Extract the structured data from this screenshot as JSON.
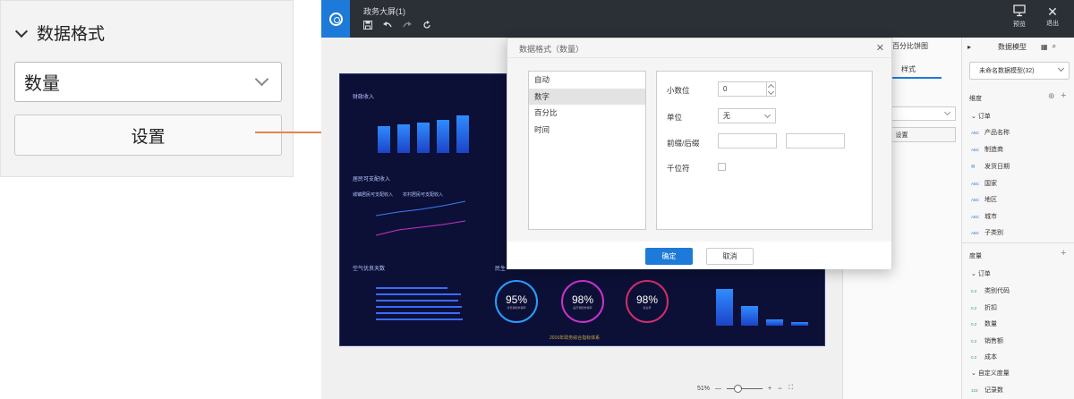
{
  "callout": {
    "section_title": "数据格式",
    "format_value": "数量",
    "settings_button": "设置"
  },
  "app": {
    "doc_title": "政务大屏(1)",
    "preview_label": "预览",
    "exit_label": "退出",
    "zoom_level": "51%"
  },
  "dashboard": {
    "panel_titles": [
      "财政收入",
      "居民可支配收入",
      "空气优良天数",
      "民生"
    ],
    "legend_items": [
      "城镇居民可支配收入",
      "农村居民可支配收入"
    ],
    "gauges": [
      {
        "pct": "95%",
        "label": "养老保险参保率"
      },
      {
        "pct": "98%",
        "label": "医疗保险参保率"
      },
      {
        "pct": "98%",
        "label": "就业率"
      }
    ],
    "footer": "2016年政务综合指标体系"
  },
  "property_panel": {
    "title": "百分比饼图",
    "tab_style": "样式",
    "settings_button": "设置"
  },
  "data_model": {
    "header_title": "数据模型",
    "model_select": "未命名数据模型(32)",
    "dimension_label": "维度",
    "measure_label": "度量",
    "dim_group": "订单",
    "dimensions": [
      {
        "tag": "ABC",
        "name": "产品名称"
      },
      {
        "tag": "ABC",
        "name": "制造商"
      },
      {
        "tag": "date",
        "name": "发货日期"
      },
      {
        "tag": "ABC",
        "name": "国家"
      },
      {
        "tag": "ABC",
        "name": "地区"
      },
      {
        "tag": "ABC",
        "name": "城市"
      },
      {
        "tag": "ABC",
        "name": "子类别"
      }
    ],
    "measure_group": "订单",
    "measures": [
      {
        "tag": "0.2",
        "name": "类别代码"
      },
      {
        "tag": "0.2",
        "name": "折扣"
      },
      {
        "tag": "0.2",
        "name": "数量"
      },
      {
        "tag": "0.2",
        "name": "销售额"
      },
      {
        "tag": "0.2",
        "name": "成本"
      }
    ],
    "custom_group": "自定义度量",
    "custom_measures": [
      {
        "tag": "123",
        "name": "记录数"
      }
    ]
  },
  "modal": {
    "title": "数据格式（数量）",
    "types": [
      "自动",
      "数字",
      "百分比",
      "时间"
    ],
    "selected_type": "数字",
    "decimal_label": "小数位",
    "decimal_value": "0",
    "unit_label": "单位",
    "unit_value": "无",
    "prefix_suffix_label": "前缀/后缀",
    "thousands_label": "千位符",
    "ok_button": "确定",
    "cancel_button": "取消"
  },
  "colors": {
    "accent": "#1d7ad8",
    "topbar": "#2b2f36",
    "dashboard_bg": "#0c1036",
    "connector": "#e8844a"
  }
}
